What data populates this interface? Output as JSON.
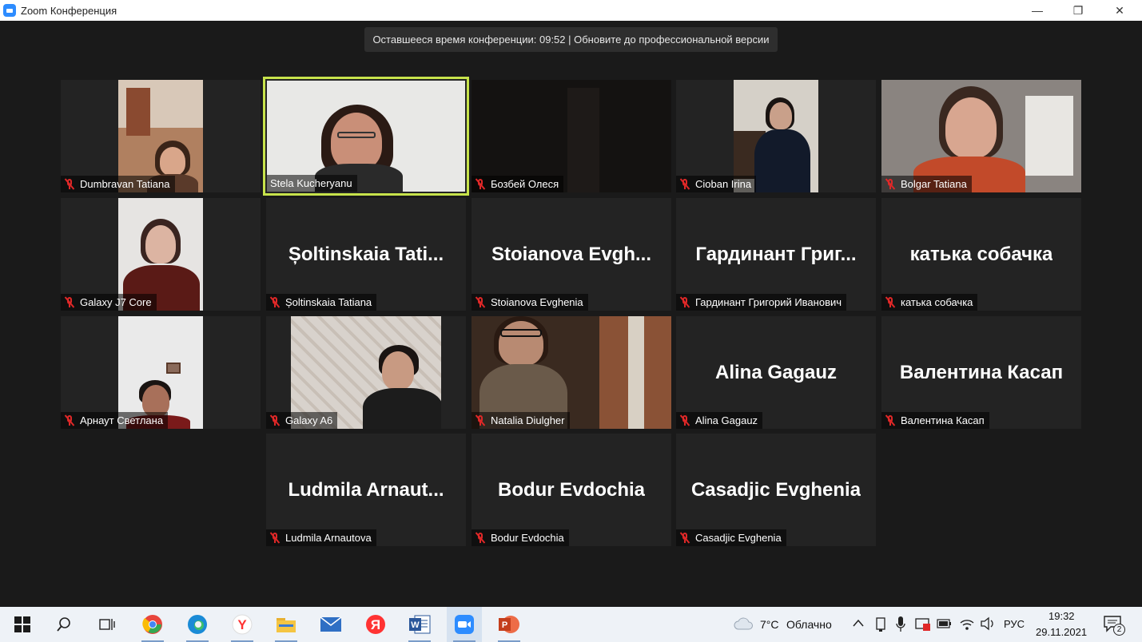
{
  "window": {
    "title": "Zoom Конференция",
    "minimize": "—",
    "maximize": "❐",
    "close": "✕"
  },
  "banner": {
    "text": "Оставшееся время конференции: 09:52 | Обновите до профессиональной версии"
  },
  "participants": [
    {
      "name": "Dumbravan Tatiana",
      "video": true,
      "muted": true
    },
    {
      "name": "Stela  Kucheryanu",
      "video": true,
      "muted": false,
      "active_speaker": true
    },
    {
      "name": "Бозбей Олеся",
      "video": true,
      "muted": true
    },
    {
      "name": "Cioban Irina",
      "video": true,
      "muted": true
    },
    {
      "name": "Bolgar Tatiana",
      "video": true,
      "muted": true
    },
    {
      "name": "Galaxy J7 Core",
      "video": true,
      "muted": true
    },
    {
      "name": "Șoltinskaia Tatiana",
      "display_name": "Șoltinskaia  Tati...",
      "video": false,
      "muted": true
    },
    {
      "name": "Stoianova Evghenia",
      "display_name": "Stoianova  Evgh...",
      "video": false,
      "muted": true
    },
    {
      "name": "Гардинант Григорий Иванович",
      "display_name": "Гардинант  Григ...",
      "video": false,
      "muted": true
    },
    {
      "name": "катька собачка",
      "display_name": "катька собачка",
      "video": false,
      "muted": true
    },
    {
      "name": "Арнаут Светлана",
      "video": true,
      "muted": true
    },
    {
      "name": "Galaxy A6",
      "video": true,
      "muted": true
    },
    {
      "name": "Natalia Diulgher",
      "video": true,
      "muted": true
    },
    {
      "name": "Alina Gagauz",
      "display_name": "Alina Gagauz",
      "video": false,
      "muted": true
    },
    {
      "name": "Валентина Касап",
      "display_name": "Валентина Касап",
      "video": false,
      "muted": true
    },
    {
      "name": "Ludmila Arnautova",
      "display_name": "Ludmila  Arnaut...",
      "video": false,
      "muted": true
    },
    {
      "name": "Bodur Evdochia",
      "display_name": "Bodur Evdochia",
      "video": false,
      "muted": true
    },
    {
      "name": "Casadjic Evghenia",
      "display_name": "Casadjic Evghenia",
      "video": false,
      "muted": true
    }
  ],
  "taskbar": {
    "apps": [
      {
        "name": "search-icon"
      },
      {
        "name": "task-view-icon"
      },
      {
        "name": "chrome-icon",
        "color": "#e8453c"
      },
      {
        "name": "edge-icon",
        "color": "#1a8bd6"
      },
      {
        "name": "yandex-browser-icon",
        "color": "#ff3333"
      },
      {
        "name": "file-explorer-icon",
        "color": "#f5c542"
      },
      {
        "name": "mail-icon",
        "color": "#2f6fc4"
      },
      {
        "name": "yandex-icon",
        "color": "#f33"
      },
      {
        "name": "word-icon",
        "color": "#2b579a"
      },
      {
        "name": "zoom-icon",
        "color": "#2d8cff"
      },
      {
        "name": "powerpoint-icon",
        "color": "#d04423"
      }
    ],
    "weather": {
      "temp": "7°C",
      "condition": "Облачно"
    },
    "language": "РУС",
    "time": "19:32",
    "date": "29.11.2021",
    "notifications": "2"
  }
}
